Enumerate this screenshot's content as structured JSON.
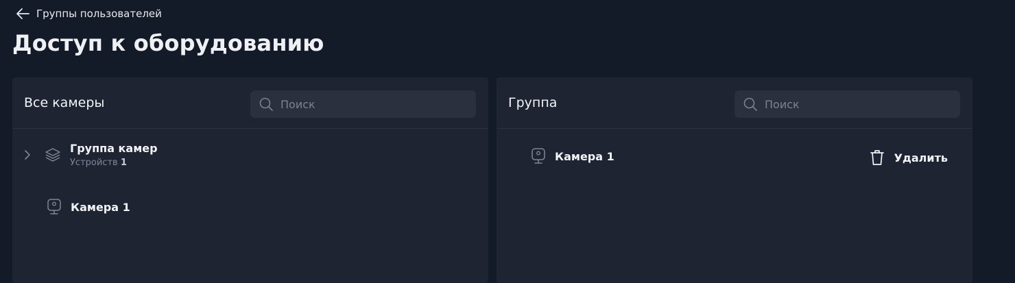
{
  "nav": {
    "back_label": "Группы пользователей"
  },
  "page": {
    "title": "Доступ к оборудованию"
  },
  "left_panel": {
    "title": "Все камеры",
    "search_placeholder": "Поиск",
    "group": {
      "name": "Группа камер",
      "devices_label": "Устройств",
      "devices_count": "1"
    },
    "camera": {
      "name": "Камера 1"
    }
  },
  "right_panel": {
    "title": "Группа",
    "search_placeholder": "Поиск",
    "items": [
      {
        "name": "Камера 1",
        "delete_label": "Удалить"
      }
    ]
  },
  "colors": {
    "background": "#131a28",
    "panel": "#1e2432",
    "search_bg": "#2a303d",
    "muted_text": "#7f8696"
  }
}
